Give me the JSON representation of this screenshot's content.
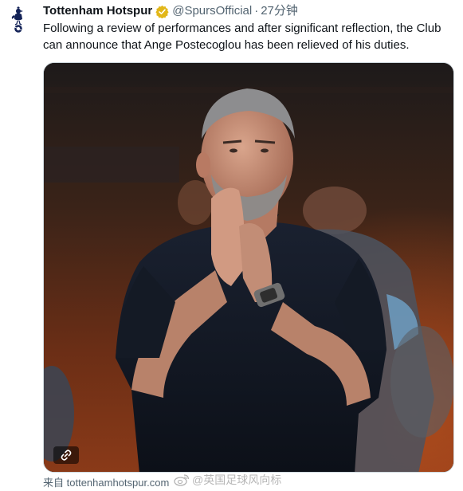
{
  "tweet": {
    "author_name": "Tottenham Hotspur",
    "handle": "@SpursOfficial",
    "separator": "·",
    "time": "27分钟",
    "text": "Following a review of performances and after significant reflection, the Club can announce that Ange Postecoglou has been relieved of his duties."
  },
  "media": {
    "link_icon": "link-icon"
  },
  "source": {
    "prefix": "来自",
    "url": "tottenhamhotspur.com"
  },
  "watermark": {
    "text": "@英国足球风向标",
    "icon": "weibo-icon"
  },
  "colors": {
    "text": "#0f1419",
    "secondary": "#536471",
    "verified_gold": "#e2b719",
    "club_navy": "#132257"
  }
}
